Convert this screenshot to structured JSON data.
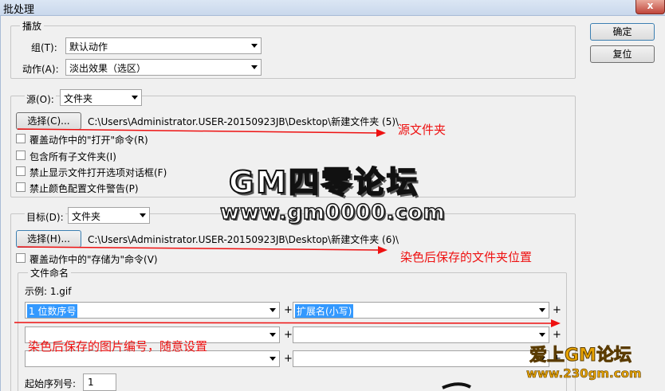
{
  "window": {
    "title": "批处理",
    "close_label": "x"
  },
  "play": {
    "legend": "播放",
    "group_label": "组(T):",
    "group_value": "默认动作",
    "action_label": "动作(A):",
    "action_value": "淡出效果（选区）"
  },
  "source": {
    "label": "源(O):",
    "value": "文件夹",
    "choose_button": "选择(C)...",
    "path": "C:\\Users\\Administrator.USER-20150923JB\\Desktop\\新建文件夹 (5)\\",
    "checks": [
      "覆盖动作中的\"打开\"命令(R)",
      "包含所有子文件夹(I)",
      "禁止显示文件打开选项对话框(F)",
      "禁止颜色配置文件警告(P)"
    ]
  },
  "dest": {
    "label": "目标(D):",
    "value": "文件夹",
    "choose_button": "选择(H)...",
    "path": "C:\\Users\\Administrator.USER-20150923JB\\Desktop\\新建文件夹 (6)\\",
    "check": "覆盖动作中的\"存储为\"命令(V)"
  },
  "naming": {
    "legend": "文件命名",
    "example": "示例: 1.gif",
    "field1": "1 位数序号",
    "field2": "扩展名(小写)",
    "plus": "+",
    "start_label": "起始序列号:",
    "start_value": "1"
  },
  "buttons": {
    "ok": "确定",
    "reset": "复位"
  },
  "annotations": {
    "source_folder": "源文件夹",
    "dest_folder": "染色后保存的文件夹位置",
    "numbering": "染色后保存的图片编号，随意设置"
  },
  "watermark": {
    "line1": "GM四零论坛",
    "line2": "www.gm0000.com"
  },
  "logo": {
    "line1": "爱上GM论坛",
    "line2": "www.230gm.com"
  },
  "colors": {
    "annotation": "#ee1111",
    "selection": "#3399ff"
  }
}
